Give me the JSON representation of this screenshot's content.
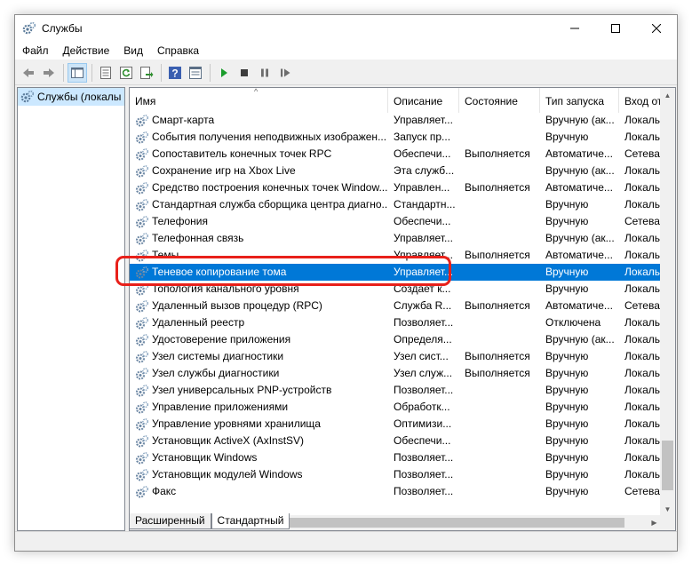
{
  "window": {
    "title": "Службы"
  },
  "menu": [
    "Файл",
    "Действие",
    "Вид",
    "Справка"
  ],
  "toolbar": {
    "icons": [
      "back-arrow-icon",
      "forward-arrow-icon",
      "console-tree-icon",
      "properties-icon",
      "refresh-icon",
      "export-list-icon",
      "help-icon",
      "details-pane-icon",
      "start-service-icon",
      "stop-service-icon",
      "pause-service-icon",
      "restart-service-icon"
    ]
  },
  "tree": {
    "root_label": "Службы (локалы"
  },
  "columns": {
    "name": "Имя",
    "description": "Описание",
    "state": "Состояние",
    "startup": "Тип запуска",
    "logon": "Вход от"
  },
  "services": [
    {
      "name": "Смарт-карта",
      "description": "Управляет...",
      "state": "",
      "startup": "Вручную (ак...",
      "logon": "Локальн"
    },
    {
      "name": "События получения неподвижных изображен...",
      "description": "Запуск пр...",
      "state": "",
      "startup": "Вручную",
      "logon": "Локальн"
    },
    {
      "name": "Сопоставитель конечных точек RPC",
      "description": "Обеспечи...",
      "state": "Выполняется",
      "startup": "Автоматиче...",
      "logon": "Сетевая"
    },
    {
      "name": "Сохранение игр на Xbox Live",
      "description": "Эта служб...",
      "state": "",
      "startup": "Вручную (ак...",
      "logon": "Локальн"
    },
    {
      "name": "Средство построения конечных точек Window...",
      "description": "Управлен...",
      "state": "Выполняется",
      "startup": "Автоматиче...",
      "logon": "Локальн"
    },
    {
      "name": "Стандартная служба сборщика центра диагно...",
      "description": "Стандартн...",
      "state": "",
      "startup": "Вручную",
      "logon": "Локальн"
    },
    {
      "name": "Телефония",
      "description": "Обеспечи...",
      "state": "",
      "startup": "Вручную",
      "logon": "Сетевая"
    },
    {
      "name": "Телефонная связь",
      "description": "Управляет...",
      "state": "",
      "startup": "Вручную (ак...",
      "logon": "Локальн"
    },
    {
      "name": "Темы",
      "description": "Управляет...",
      "state": "Выполняется",
      "startup": "Автоматиче...",
      "logon": "Локальн"
    },
    {
      "name": "Теневое копирование тома",
      "description": "Управляет...",
      "state": "",
      "startup": "Вручную",
      "logon": "Локальн",
      "selected": true
    },
    {
      "name": "Топология канального уровня",
      "description": "Создает к...",
      "state": "",
      "startup": "Вручную",
      "logon": "Локальн"
    },
    {
      "name": "Удаленный вызов процедур (RPC)",
      "description": "Служба R...",
      "state": "Выполняется",
      "startup": "Автоматиче...",
      "logon": "Сетевая"
    },
    {
      "name": "Удаленный реестр",
      "description": "Позволяет...",
      "state": "",
      "startup": "Отключена",
      "logon": "Локальн"
    },
    {
      "name": "Удостоверение приложения",
      "description": "Определя...",
      "state": "",
      "startup": "Вручную (ак...",
      "logon": "Локальн"
    },
    {
      "name": "Узел системы диагностики",
      "description": "Узел сист...",
      "state": "Выполняется",
      "startup": "Вручную",
      "logon": "Локальн"
    },
    {
      "name": "Узел службы диагностики",
      "description": "Узел служ...",
      "state": "Выполняется",
      "startup": "Вручную",
      "logon": "Локальн"
    },
    {
      "name": "Узел универсальных PNP-устройств",
      "description": "Позволяет...",
      "state": "",
      "startup": "Вручную",
      "logon": "Локальн"
    },
    {
      "name": "Управление приложениями",
      "description": "Обработк...",
      "state": "",
      "startup": "Вручную",
      "logon": "Локальн"
    },
    {
      "name": "Управление уровнями хранилища",
      "description": "Оптимизи...",
      "state": "",
      "startup": "Вручную",
      "logon": "Локальн"
    },
    {
      "name": "Установщик ActiveX (AxInstSV)",
      "description": "Обеспечи...",
      "state": "",
      "startup": "Вручную",
      "logon": "Локальн"
    },
    {
      "name": "Установщик Windows",
      "description": "Позволяет...",
      "state": "",
      "startup": "Вручную",
      "logon": "Локальн"
    },
    {
      "name": "Установщик модулей Windows",
      "description": "Позволяет...",
      "state": "",
      "startup": "Вручную",
      "logon": "Локальн"
    },
    {
      "name": "Факс",
      "description": "Позволяет...",
      "state": "",
      "startup": "Вручную",
      "logon": "Сетевая"
    }
  ],
  "tabs": [
    "Расширенный",
    "Стандартный"
  ],
  "colors": {
    "selection": "#0078d7",
    "annotation_outline": "#e8201a",
    "start_green": "#1a9c2b"
  }
}
